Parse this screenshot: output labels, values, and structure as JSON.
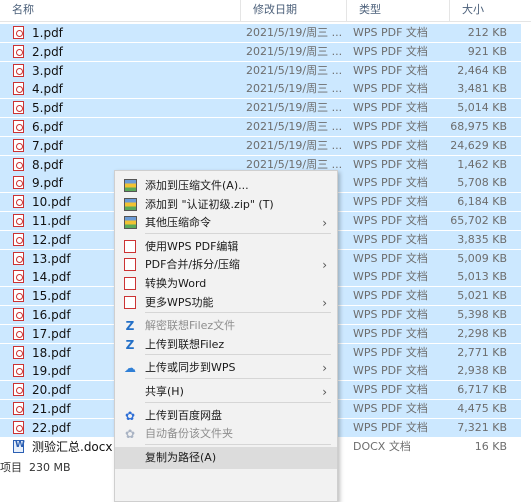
{
  "header": {
    "col_name": "名称",
    "col_date": "修改日期",
    "col_type": "类型",
    "col_size": "大小"
  },
  "files": [
    {
      "name": "1.pdf",
      "date": "2021/5/19/周三 ...",
      "type": "WPS PDF 文档",
      "size": "212 KB",
      "icon": "pdf-icon",
      "selected": true
    },
    {
      "name": "2.pdf",
      "date": "2021/5/19/周三 ...",
      "type": "WPS PDF 文档",
      "size": "921 KB",
      "icon": "pdf-icon",
      "selected": true
    },
    {
      "name": "3.pdf",
      "date": "2021/5/19/周三 ...",
      "type": "WPS PDF 文档",
      "size": "2,464 KB",
      "icon": "pdf-icon",
      "selected": true
    },
    {
      "name": "4.pdf",
      "date": "2021/5/19/周三 ...",
      "type": "WPS PDF 文档",
      "size": "3,481 KB",
      "icon": "pdf-icon",
      "selected": true
    },
    {
      "name": "5.pdf",
      "date": "2021/5/19/周三 ...",
      "type": "WPS PDF 文档",
      "size": "5,014 KB",
      "icon": "pdf-icon",
      "selected": true
    },
    {
      "name": "6.pdf",
      "date": "2021/5/19/周三 ...",
      "type": "WPS PDF 文档",
      "size": "68,975 KB",
      "icon": "pdf-icon",
      "selected": true
    },
    {
      "name": "7.pdf",
      "date": "2021/5/19/周三 ...",
      "type": "WPS PDF 文档",
      "size": "24,629 KB",
      "icon": "pdf-icon",
      "selected": true
    },
    {
      "name": "8.pdf",
      "date": "2021/5/19/周三 ...",
      "type": "WPS PDF 文档",
      "size": "1,462 KB",
      "icon": "pdf-icon",
      "selected": true
    },
    {
      "name": "9.pdf",
      "date": "",
      "type": "WPS PDF 文档",
      "size": "5,708 KB",
      "icon": "pdf-icon",
      "selected": true
    },
    {
      "name": "10.pdf",
      "date": "",
      "type": "WPS PDF 文档",
      "size": "6,184 KB",
      "icon": "pdf-icon",
      "selected": true
    },
    {
      "name": "11.pdf",
      "date": "",
      "type": "WPS PDF 文档",
      "size": "65,702 KB",
      "icon": "pdf-icon",
      "selected": true
    },
    {
      "name": "12.pdf",
      "date": "",
      "type": "WPS PDF 文档",
      "size": "3,835 KB",
      "icon": "pdf-icon",
      "selected": true
    },
    {
      "name": "13.pdf",
      "date": "",
      "type": "WPS PDF 文档",
      "size": "5,009 KB",
      "icon": "pdf-icon",
      "selected": true
    },
    {
      "name": "14.pdf",
      "date": "",
      "type": "WPS PDF 文档",
      "size": "5,013 KB",
      "icon": "pdf-icon",
      "selected": true
    },
    {
      "name": "15.pdf",
      "date": "",
      "type": "WPS PDF 文档",
      "size": "5,021 KB",
      "icon": "pdf-icon",
      "selected": true
    },
    {
      "name": "16.pdf",
      "date": "",
      "type": "WPS PDF 文档",
      "size": "5,398 KB",
      "icon": "pdf-icon",
      "selected": true
    },
    {
      "name": "17.pdf",
      "date": "",
      "type": "WPS PDF 文档",
      "size": "2,298 KB",
      "icon": "pdf-icon",
      "selected": true
    },
    {
      "name": "18.pdf",
      "date": "",
      "type": "WPS PDF 文档",
      "size": "2,771 KB",
      "icon": "pdf-icon",
      "selected": true
    },
    {
      "name": "19.pdf",
      "date": "",
      "type": "WPS PDF 文档",
      "size": "2,938 KB",
      "icon": "pdf-icon",
      "selected": true
    },
    {
      "name": "20.pdf",
      "date": "",
      "type": "WPS PDF 文档",
      "size": "6,717 KB",
      "icon": "pdf-icon",
      "selected": true
    },
    {
      "name": "21.pdf",
      "date": "",
      "type": "WPS PDF 文档",
      "size": "4,475 KB",
      "icon": "pdf-icon",
      "selected": true
    },
    {
      "name": "22.pdf",
      "date": "",
      "type": "WPS PDF 文档",
      "size": "7,321 KB",
      "icon": "pdf-icon",
      "selected": true
    },
    {
      "name": "测验汇总.docx",
      "date": "",
      "type": "DOCX 文档",
      "size": "16 KB",
      "icon": "docx-icon",
      "selected": false
    }
  ],
  "status": {
    "items_label": "项目",
    "selected_size": "230 MB"
  },
  "menu": [
    {
      "label": "添加到压缩文件(A)...",
      "icon": "archive-icon",
      "submenu": false,
      "disabled": false
    },
    {
      "label": "添加到 \"认证初级.zip\" (T)",
      "icon": "archive-icon",
      "submenu": false,
      "disabled": false
    },
    {
      "label": "其他压缩命令",
      "icon": "archive-icon",
      "submenu": true,
      "disabled": false
    },
    {
      "sep": true
    },
    {
      "label": "使用WPS PDF编辑",
      "icon": "wps-pdf-icon",
      "submenu": false,
      "disabled": false
    },
    {
      "label": "PDF合并/拆分/压缩",
      "icon": "wps-pdf-icon",
      "submenu": true,
      "disabled": false
    },
    {
      "label": "转换为Word",
      "icon": "wps-word-icon",
      "submenu": false,
      "disabled": false
    },
    {
      "label": "更多WPS功能",
      "icon": "wps-pdf-icon",
      "submenu": true,
      "disabled": false
    },
    {
      "sep": true
    },
    {
      "label": "解密联想Filez文件",
      "icon": "filez-icon",
      "submenu": false,
      "disabled": true
    },
    {
      "label": "上传到联想Filez",
      "icon": "filez-icon",
      "submenu": false,
      "disabled": false
    },
    {
      "sep": true
    },
    {
      "label": "上传或同步到WPS",
      "icon": "cloud-upload-icon",
      "submenu": true,
      "disabled": false
    },
    {
      "sep": true
    },
    {
      "label": "共享(H)",
      "icon": "",
      "submenu": true,
      "disabled": false
    },
    {
      "sep": true
    },
    {
      "label": "上传到百度网盘",
      "icon": "baidu-pan-icon",
      "submenu": false,
      "disabled": false
    },
    {
      "label": "自动备份该文件夹",
      "icon": "baidu-pan-icon",
      "submenu": false,
      "disabled": true
    },
    {
      "sep": true
    },
    {
      "label": "复制为路径(A)",
      "icon": "",
      "submenu": false,
      "disabled": false,
      "highlighted": true
    }
  ],
  "colors": {
    "selection": "#cce8ff",
    "header_text": "#4c607a",
    "menu_bg": "#f2f2f2"
  }
}
